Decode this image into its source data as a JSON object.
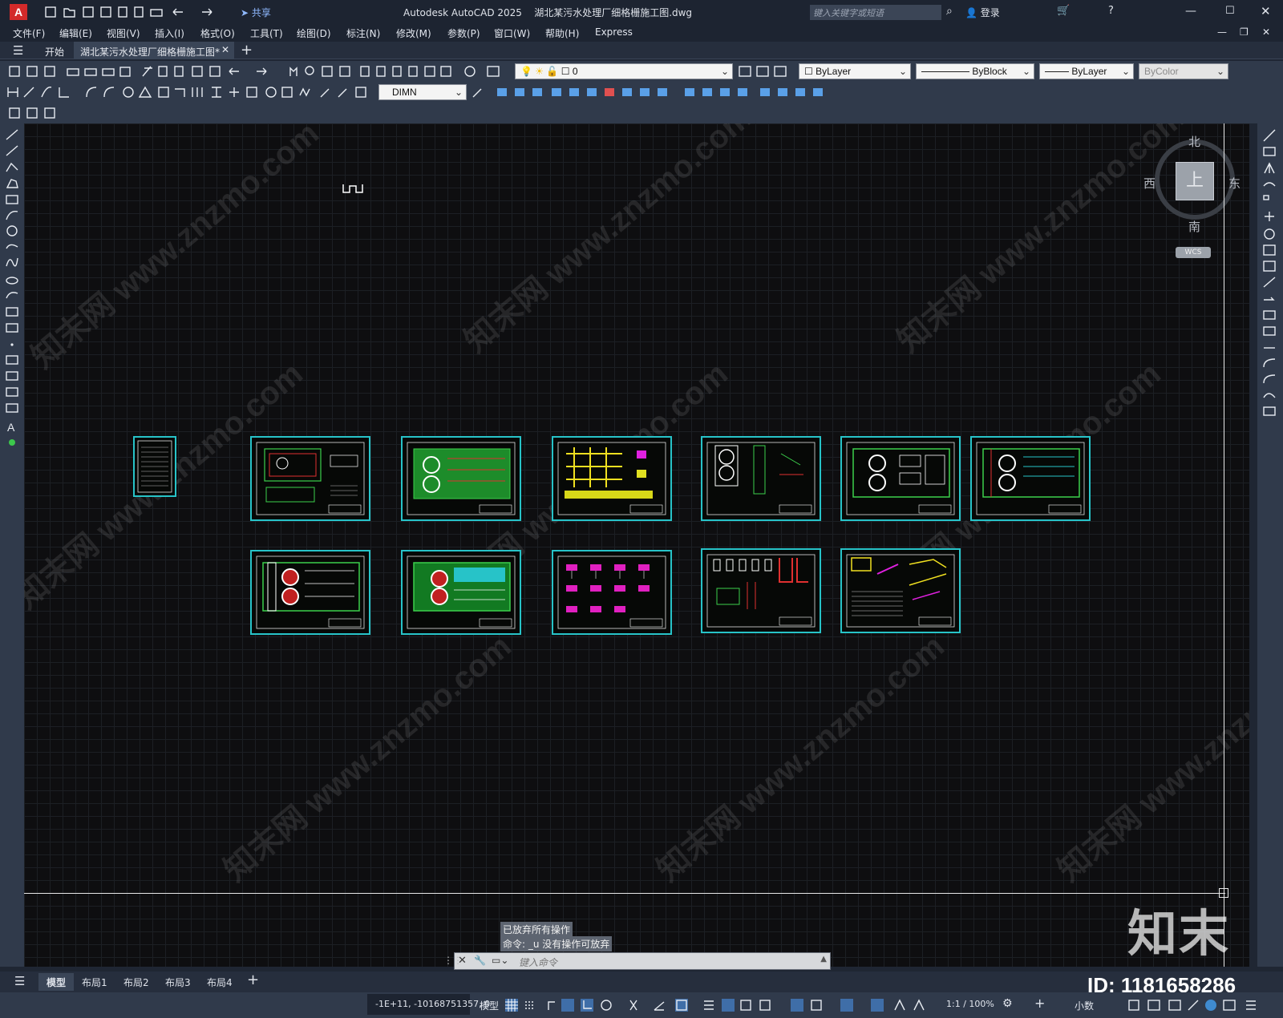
{
  "app": {
    "title": "Autodesk AutoCAD 2025",
    "document": "湖北某污水处理厂细格栅施工图.dwg",
    "share_label": "共享",
    "search_placeholder": "键入关键字或短语",
    "login_label": "登录"
  },
  "menu": [
    "文件(F)",
    "编辑(E)",
    "视图(V)",
    "插入(I)",
    "格式(O)",
    "工具(T)",
    "绘图(D)",
    "标注(N)",
    "修改(M)",
    "参数(P)",
    "窗口(W)",
    "帮助(H)",
    "Express"
  ],
  "tabs": {
    "start": "开始",
    "active": "湖北某污水处理厂细格栅施工图*"
  },
  "properties": {
    "layer": "0",
    "color": "ByLayer",
    "linetype": "ByBlock",
    "lineweight": "ByLayer",
    "plotstyle": "ByColor",
    "dimstyle": "DIMN"
  },
  "viewcube": {
    "north": "北",
    "south": "南",
    "east": "东",
    "west": "西",
    "face": "上",
    "wcs": "WCS"
  },
  "command": {
    "history": [
      "已放弃所有操作",
      "命令: _u 没有操作可放弃"
    ],
    "placeholder": "键入命令"
  },
  "layouts": [
    "模型",
    "布局1",
    "布局2",
    "布局3",
    "布局4"
  ],
  "status": {
    "coords": "-1E+11, -10168751357, 0",
    "model": "模型",
    "scale": "1:1 / 100%",
    "units": "小数"
  },
  "watermark": {
    "brand": "知末",
    "id": "ID: 1181658286",
    "url_text": "知末网 www.znzmo.com"
  },
  "colors": {
    "sheet_border": "#27c3c8",
    "accent_red": "#e03030",
    "canvas_bg": "#0e0e10"
  }
}
